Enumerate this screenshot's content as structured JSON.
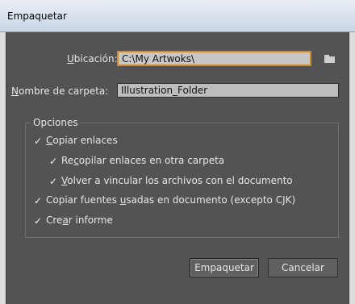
{
  "window": {
    "title": "Empaquetar"
  },
  "location": {
    "label_pre": "",
    "label_u": "U",
    "label_post": "bicación:",
    "value": "C:\\My Artwoks\\"
  },
  "folder_name": {
    "label_pre": "",
    "label_u": "N",
    "label_post": "ombre de carpeta:",
    "value": "Illustration_Folder"
  },
  "options": {
    "legend": "Opciones",
    "copy_links": {
      "checked_glyph": "✓",
      "pre": "",
      "u": "C",
      "post": "opiar enlaces"
    },
    "collect_links": {
      "checked_glyph": "✓",
      "pre": "Re",
      "u": "c",
      "post": "opilar enlaces en otra carpeta"
    },
    "relink": {
      "checked_glyph": "✓",
      "pre": "",
      "u": "V",
      "post": "olver a vincular los archivos con el documento"
    },
    "copy_fonts": {
      "checked_glyph": "✓",
      "pre": "Copiar fuentes ",
      "u": "u",
      "post": "sadas en documento (excepto CJK)"
    },
    "create_report": {
      "checked_glyph": "✓",
      "pre": "Cre",
      "u": "a",
      "post": "r informe"
    }
  },
  "buttons": {
    "package": "Empaquetar",
    "cancel": "Cancelar"
  },
  "colors": {
    "dialog_bg": "#535353",
    "focus_border": "#d08a2c"
  }
}
